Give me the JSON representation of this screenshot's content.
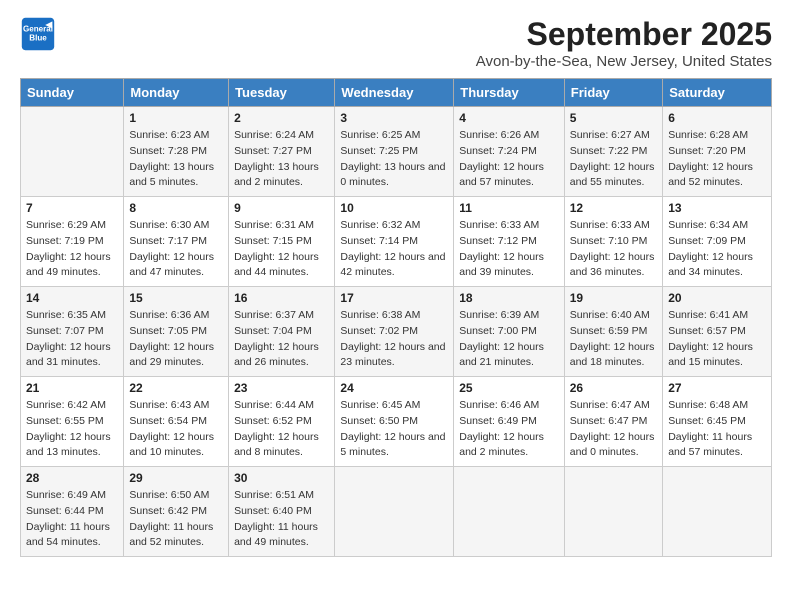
{
  "logo": {
    "line1": "General",
    "line2": "Blue"
  },
  "title": "September 2025",
  "subtitle": "Avon-by-the-Sea, New Jersey, United States",
  "days_header": [
    "Sunday",
    "Monday",
    "Tuesday",
    "Wednesday",
    "Thursday",
    "Friday",
    "Saturday"
  ],
  "weeks": [
    [
      {
        "day": "",
        "sunrise": "",
        "sunset": "",
        "daylight": ""
      },
      {
        "day": "1",
        "sunrise": "Sunrise: 6:23 AM",
        "sunset": "Sunset: 7:28 PM",
        "daylight": "Daylight: 13 hours and 5 minutes."
      },
      {
        "day": "2",
        "sunrise": "Sunrise: 6:24 AM",
        "sunset": "Sunset: 7:27 PM",
        "daylight": "Daylight: 13 hours and 2 minutes."
      },
      {
        "day": "3",
        "sunrise": "Sunrise: 6:25 AM",
        "sunset": "Sunset: 7:25 PM",
        "daylight": "Daylight: 13 hours and 0 minutes."
      },
      {
        "day": "4",
        "sunrise": "Sunrise: 6:26 AM",
        "sunset": "Sunset: 7:24 PM",
        "daylight": "Daylight: 12 hours and 57 minutes."
      },
      {
        "day": "5",
        "sunrise": "Sunrise: 6:27 AM",
        "sunset": "Sunset: 7:22 PM",
        "daylight": "Daylight: 12 hours and 55 minutes."
      },
      {
        "day": "6",
        "sunrise": "Sunrise: 6:28 AM",
        "sunset": "Sunset: 7:20 PM",
        "daylight": "Daylight: 12 hours and 52 minutes."
      }
    ],
    [
      {
        "day": "7",
        "sunrise": "Sunrise: 6:29 AM",
        "sunset": "Sunset: 7:19 PM",
        "daylight": "Daylight: 12 hours and 49 minutes."
      },
      {
        "day": "8",
        "sunrise": "Sunrise: 6:30 AM",
        "sunset": "Sunset: 7:17 PM",
        "daylight": "Daylight: 12 hours and 47 minutes."
      },
      {
        "day": "9",
        "sunrise": "Sunrise: 6:31 AM",
        "sunset": "Sunset: 7:15 PM",
        "daylight": "Daylight: 12 hours and 44 minutes."
      },
      {
        "day": "10",
        "sunrise": "Sunrise: 6:32 AM",
        "sunset": "Sunset: 7:14 PM",
        "daylight": "Daylight: 12 hours and 42 minutes."
      },
      {
        "day": "11",
        "sunrise": "Sunrise: 6:33 AM",
        "sunset": "Sunset: 7:12 PM",
        "daylight": "Daylight: 12 hours and 39 minutes."
      },
      {
        "day": "12",
        "sunrise": "Sunrise: 6:33 AM",
        "sunset": "Sunset: 7:10 PM",
        "daylight": "Daylight: 12 hours and 36 minutes."
      },
      {
        "day": "13",
        "sunrise": "Sunrise: 6:34 AM",
        "sunset": "Sunset: 7:09 PM",
        "daylight": "Daylight: 12 hours and 34 minutes."
      }
    ],
    [
      {
        "day": "14",
        "sunrise": "Sunrise: 6:35 AM",
        "sunset": "Sunset: 7:07 PM",
        "daylight": "Daylight: 12 hours and 31 minutes."
      },
      {
        "day": "15",
        "sunrise": "Sunrise: 6:36 AM",
        "sunset": "Sunset: 7:05 PM",
        "daylight": "Daylight: 12 hours and 29 minutes."
      },
      {
        "day": "16",
        "sunrise": "Sunrise: 6:37 AM",
        "sunset": "Sunset: 7:04 PM",
        "daylight": "Daylight: 12 hours and 26 minutes."
      },
      {
        "day": "17",
        "sunrise": "Sunrise: 6:38 AM",
        "sunset": "Sunset: 7:02 PM",
        "daylight": "Daylight: 12 hours and 23 minutes."
      },
      {
        "day": "18",
        "sunrise": "Sunrise: 6:39 AM",
        "sunset": "Sunset: 7:00 PM",
        "daylight": "Daylight: 12 hours and 21 minutes."
      },
      {
        "day": "19",
        "sunrise": "Sunrise: 6:40 AM",
        "sunset": "Sunset: 6:59 PM",
        "daylight": "Daylight: 12 hours and 18 minutes."
      },
      {
        "day": "20",
        "sunrise": "Sunrise: 6:41 AM",
        "sunset": "Sunset: 6:57 PM",
        "daylight": "Daylight: 12 hours and 15 minutes."
      }
    ],
    [
      {
        "day": "21",
        "sunrise": "Sunrise: 6:42 AM",
        "sunset": "Sunset: 6:55 PM",
        "daylight": "Daylight: 12 hours and 13 minutes."
      },
      {
        "day": "22",
        "sunrise": "Sunrise: 6:43 AM",
        "sunset": "Sunset: 6:54 PM",
        "daylight": "Daylight: 12 hours and 10 minutes."
      },
      {
        "day": "23",
        "sunrise": "Sunrise: 6:44 AM",
        "sunset": "Sunset: 6:52 PM",
        "daylight": "Daylight: 12 hours and 8 minutes."
      },
      {
        "day": "24",
        "sunrise": "Sunrise: 6:45 AM",
        "sunset": "Sunset: 6:50 PM",
        "daylight": "Daylight: 12 hours and 5 minutes."
      },
      {
        "day": "25",
        "sunrise": "Sunrise: 6:46 AM",
        "sunset": "Sunset: 6:49 PM",
        "daylight": "Daylight: 12 hours and 2 minutes."
      },
      {
        "day": "26",
        "sunrise": "Sunrise: 6:47 AM",
        "sunset": "Sunset: 6:47 PM",
        "daylight": "Daylight: 12 hours and 0 minutes."
      },
      {
        "day": "27",
        "sunrise": "Sunrise: 6:48 AM",
        "sunset": "Sunset: 6:45 PM",
        "daylight": "Daylight: 11 hours and 57 minutes."
      }
    ],
    [
      {
        "day": "28",
        "sunrise": "Sunrise: 6:49 AM",
        "sunset": "Sunset: 6:44 PM",
        "daylight": "Daylight: 11 hours and 54 minutes."
      },
      {
        "day": "29",
        "sunrise": "Sunrise: 6:50 AM",
        "sunset": "Sunset: 6:42 PM",
        "daylight": "Daylight: 11 hours and 52 minutes."
      },
      {
        "day": "30",
        "sunrise": "Sunrise: 6:51 AM",
        "sunset": "Sunset: 6:40 PM",
        "daylight": "Daylight: 11 hours and 49 minutes."
      },
      {
        "day": "",
        "sunrise": "",
        "sunset": "",
        "daylight": ""
      },
      {
        "day": "",
        "sunrise": "",
        "sunset": "",
        "daylight": ""
      },
      {
        "day": "",
        "sunrise": "",
        "sunset": "",
        "daylight": ""
      },
      {
        "day": "",
        "sunrise": "",
        "sunset": "",
        "daylight": ""
      }
    ]
  ]
}
